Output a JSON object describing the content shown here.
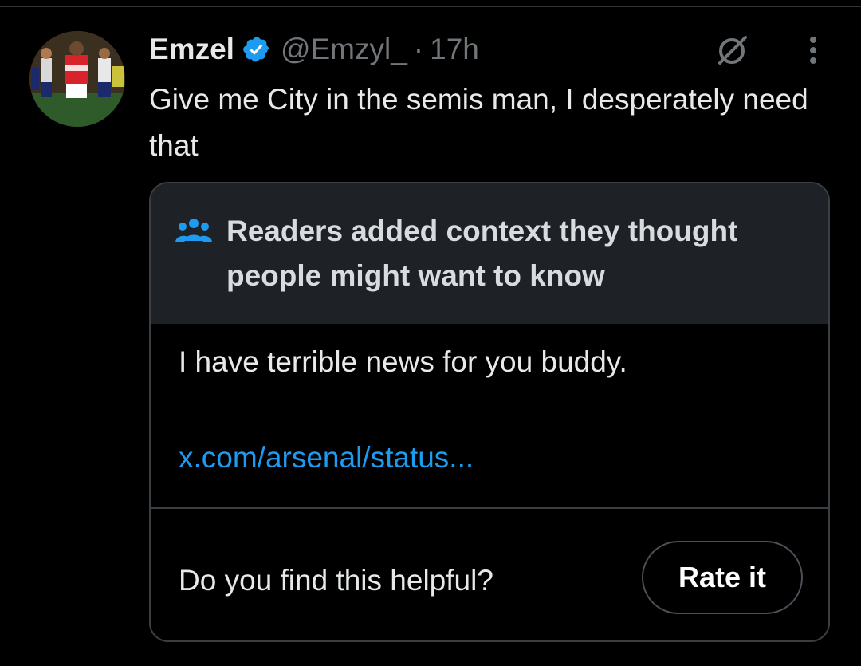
{
  "tweet": {
    "display_name": "Emzel",
    "handle": "@Emzyl_",
    "separator": "·",
    "time": "17h",
    "text": "Give me City in the semis man, I desperately need that",
    "avatar_icon": "avatar-photo-football-players",
    "verified_icon": "verified-badge-icon",
    "verified_color": "#1d9bf0",
    "action_icons": [
      "grok-icon",
      "more-icon"
    ]
  },
  "community_note": {
    "icon": "readers-group-icon",
    "icon_color": "#1d9bf0",
    "title": "Readers added context they thought people might want to know",
    "body": "I have terrible news for you buddy.",
    "link": "x.com/arsenal/status...",
    "link_color": "#1d9bf0",
    "helpful_question": "Do you find this helpful?",
    "rate_button_label": "Rate it"
  },
  "colors": {
    "background": "#000000",
    "text_primary": "#e7e9ea",
    "text_secondary": "#71767b",
    "note_header_bg": "#1e2227",
    "border": "#3a3f44"
  }
}
